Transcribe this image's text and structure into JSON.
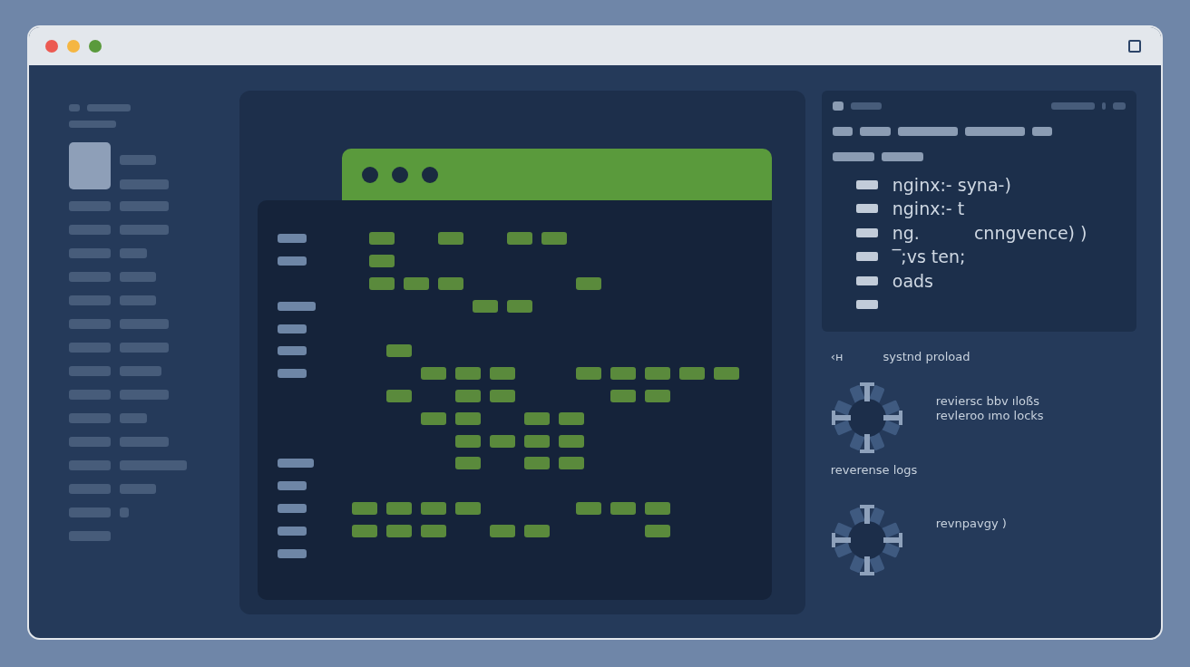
{
  "terminal_panel": {
    "lines": [
      {
        "parts": [
          "nginx:- syna-)"
        ]
      },
      {
        "parts": [
          "nginx:- t"
        ]
      },
      {
        "parts": [
          "ng.",
          "cnngvence) )"
        ]
      },
      {
        "parts": [
          "‾;vs ten;"
        ]
      },
      {
        "parts": [
          "oads"
        ]
      }
    ]
  },
  "status_panel": {
    "header": {
      "glyph": "‹ʜ",
      "title": "systnd proload"
    },
    "items": [
      {
        "kind": "service",
        "lines": [
          "reviersc bbv ıloßs",
          "revleroo ımo locks"
        ]
      },
      {
        "kind": "label",
        "text": "reverense logs"
      },
      {
        "kind": "service",
        "lines": [
          "revnpavgy )"
        ]
      }
    ]
  }
}
